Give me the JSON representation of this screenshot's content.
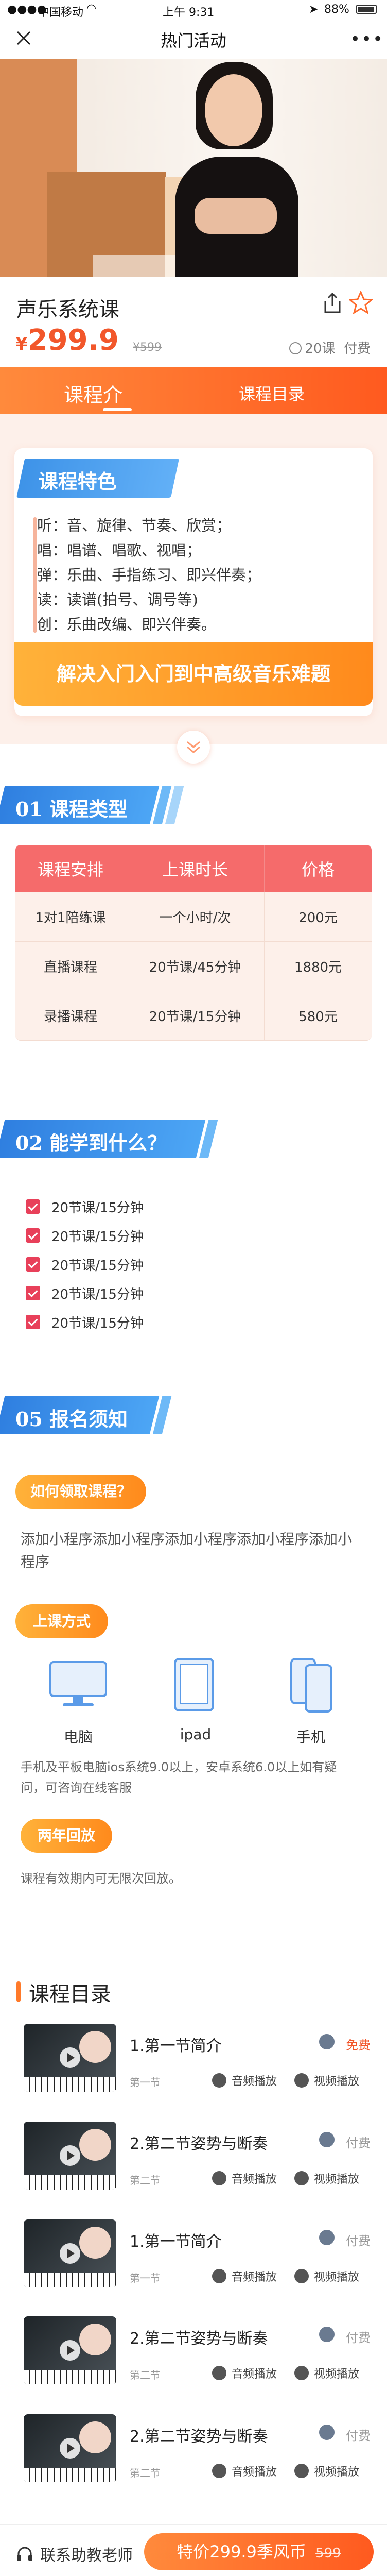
{
  "status_bar": {
    "carrier": "中国移动",
    "time": "上午 9:31",
    "battery": "88%"
  },
  "nav": {
    "title": "热门活动"
  },
  "course": {
    "title": "声乐系统课",
    "price_symbol": "¥",
    "price": "299.9",
    "price_old": "¥599",
    "lessons": "20课",
    "pay": "付费"
  },
  "tabs": [
    {
      "label": "课程介绍",
      "active": true
    },
    {
      "label": "课程目录",
      "active": false
    }
  ],
  "features": {
    "heading": "课程特色",
    "lines": [
      "听：音、旋律、节奏、欣赏；",
      "唱：唱谱、唱歌、视唱；",
      "弹：乐曲、手指练习、即兴伴奏；",
      "读：读谱(拍号、调号等)",
      "创：乐曲改编、即兴伴奏。"
    ],
    "button": "解决入门入门到中高级音乐难题"
  },
  "section1": {
    "heading": "01 课程类型"
  },
  "table": {
    "headers": [
      "课程安排",
      "上课时长",
      "价格"
    ],
    "rows": [
      [
        "1对1陪练课",
        "一个小时/次",
        "200元"
      ],
      [
        "直播课程",
        "20节课/45分钟",
        "1880元"
      ],
      [
        "录播课程",
        "20节课/15分钟",
        "580元"
      ]
    ]
  },
  "section2": {
    "heading": "02 能学到什么？"
  },
  "checklist": [
    "20节课/15分钟",
    "20节课/15分钟",
    "20节课/15分钟",
    "20节课/15分钟",
    "20节课/15分钟"
  ],
  "section5": {
    "heading": "05 报名须知"
  },
  "howto": {
    "pill": "如何领取课程？",
    "text": "添加小程序添加小程序添加小程序添加小程序添加小程序"
  },
  "mode": {
    "pill": "上课方式",
    "devices": [
      "电脑",
      "ipad",
      "手机"
    ],
    "note": "手机及平板电脑ios系统9.0以上，安卓系统6.0以上如有疑问，可咨询在线客服"
  },
  "review": {
    "pill": "两年回放",
    "text": "课程有效期内可无限次回放。"
  },
  "catalog": {
    "title": "课程目录",
    "audio_label": "音频播放",
    "video_label": "视频播放",
    "items": [
      {
        "title": "1.第一节简介",
        "sub": "第一节",
        "tag": "免费",
        "free": true
      },
      {
        "title": "2.第二节姿势与断奏",
        "sub": "第二节",
        "tag": "付费",
        "free": false
      },
      {
        "title": "1.第一节简介",
        "sub": "第一节",
        "tag": "付费",
        "free": false
      },
      {
        "title": "2.第二节姿势与断奏",
        "sub": "第二节",
        "tag": "付费",
        "free": false
      },
      {
        "title": "2.第二节姿势与断奏",
        "sub": "第二节",
        "tag": "付费",
        "free": false
      }
    ]
  },
  "bottom": {
    "contact": "联系助教老师",
    "buy": "特价299.9季风币",
    "buy_old": "599"
  },
  "colors": {
    "accent": "#ff5a1f",
    "blue": "#3e93e8",
    "red": "#f56b6b"
  }
}
